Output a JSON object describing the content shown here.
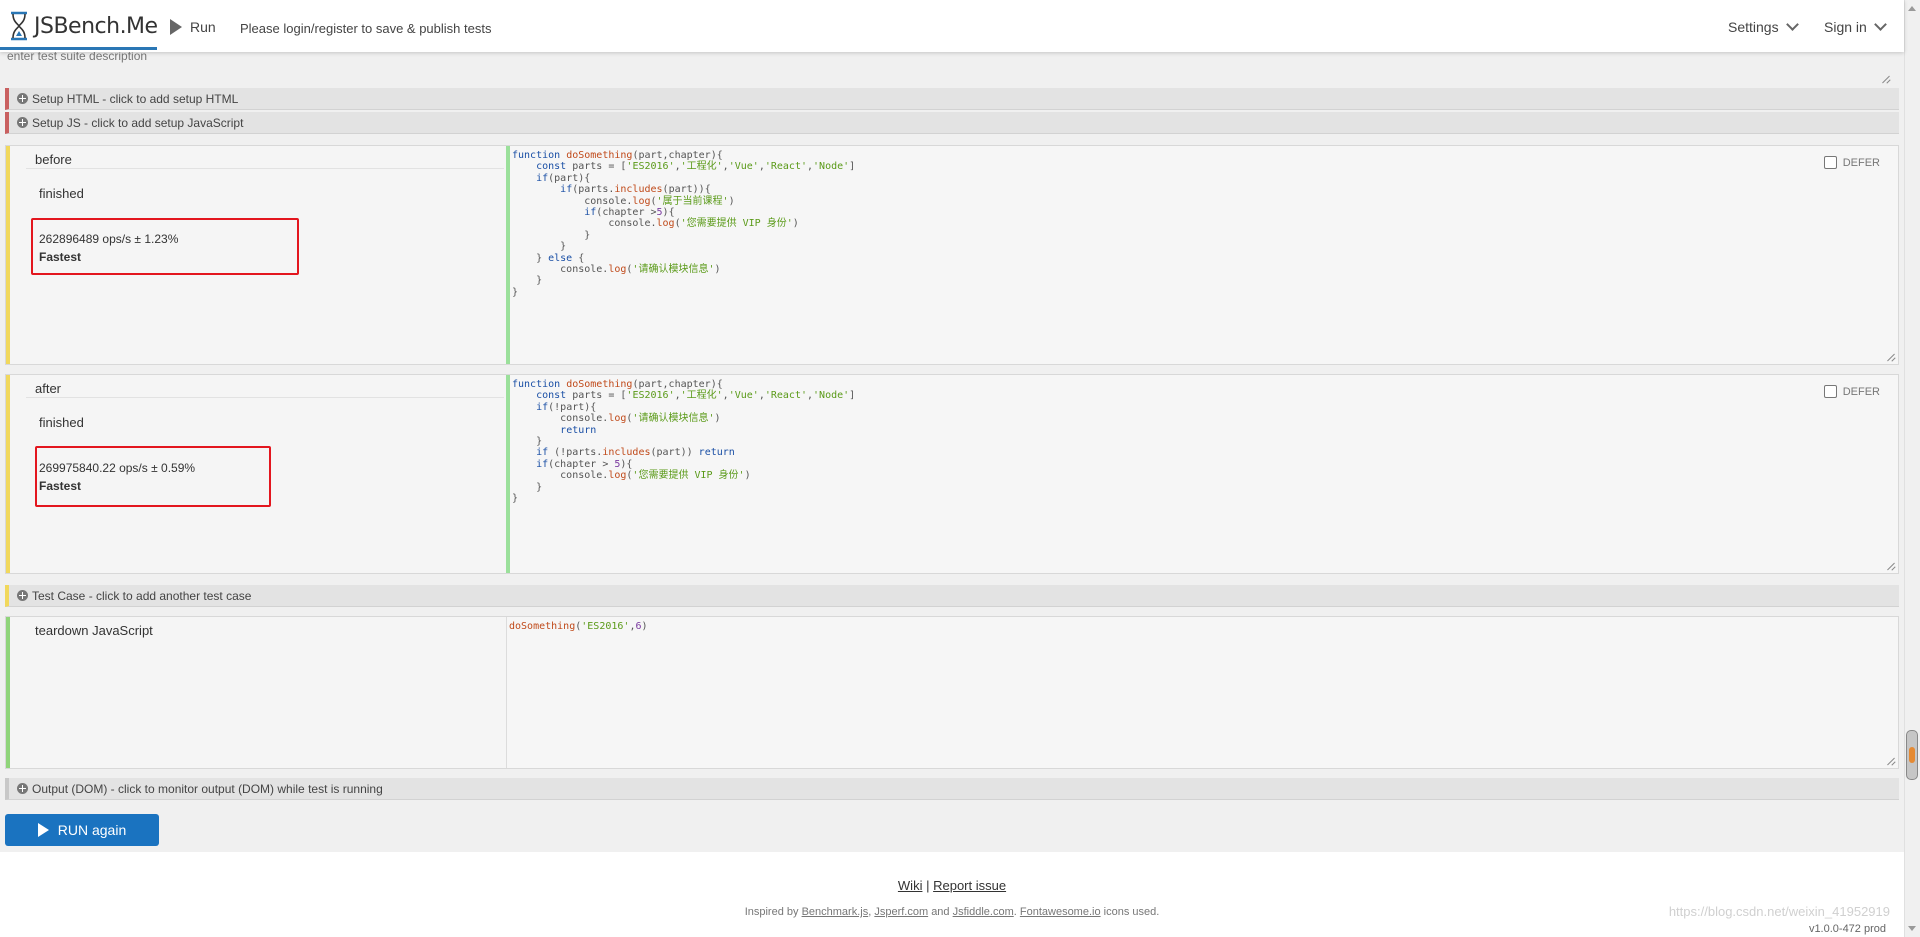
{
  "header": {
    "brand": "JSBench.Me",
    "run_label": "Run",
    "login_text": "Please login/register to save & publish tests",
    "settings_label": "Settings",
    "signin_label": "Sign in"
  },
  "description": {
    "placeholder": "enter test suite description"
  },
  "sections": {
    "setup_html": "Setup HTML - click to add setup HTML",
    "setup_js": "Setup JS - click to add setup JavaScript",
    "add_test_case": "Test Case - click to add another test case",
    "output_dom": "Output (DOM) - click to monitor output (DOM) while test is running"
  },
  "test_cases": [
    {
      "title": "before",
      "status": "finished",
      "ops": "262896489 ops/s ± 1.23%",
      "rank": "Fastest",
      "defer_label": "DEFER"
    },
    {
      "title": "after",
      "status": "finished",
      "ops": "269975840.22 ops/s ± 0.59%",
      "rank": "Fastest",
      "defer_label": "DEFER"
    }
  ],
  "teardown": {
    "title": "teardown JavaScript"
  },
  "run_button": "RUN again",
  "footer": {
    "wiki": "Wiki",
    "separator": "|",
    "report": "Report issue",
    "inspired_prefix": "Inspired by",
    "benchmark": "Benchmark.js",
    "jsperf": "Jsperf.com",
    "and": "and",
    "jsfiddle": "Jsfiddle.com",
    "fontawesome": "Fontawesome.io",
    "icons_used": "icons used.",
    "version": "v1.0.0-472 prod",
    "watermark": "https://blog.csdn.net/weixin_41952919"
  },
  "colors": {
    "accent_blue": "#1a73c0",
    "setup_bar_red": "#c96060",
    "case_bar_yellow": "#f1d85c",
    "teardown_bar_green": "#8fd47a",
    "highlight_red": "#e3161e"
  },
  "icons": [
    "hourglass-logo-icon",
    "play-icon",
    "chevron-down-icon",
    "plus-circle-icon",
    "checkbox-icon"
  ]
}
